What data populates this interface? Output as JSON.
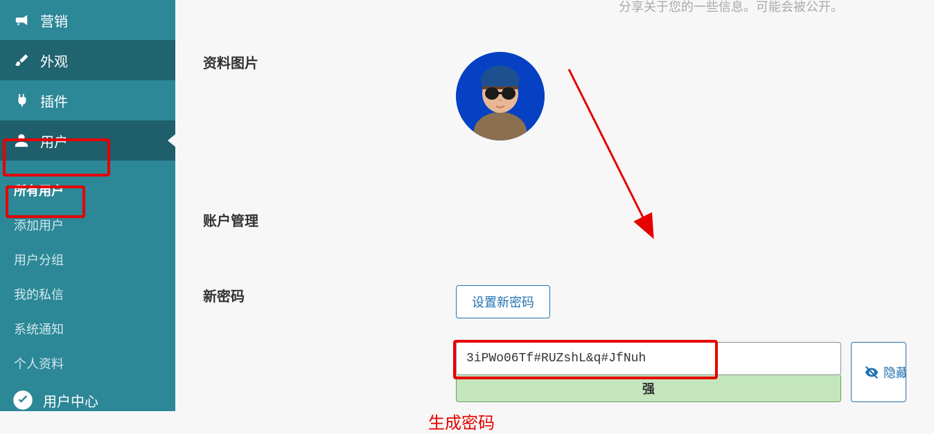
{
  "sidebar": {
    "items": [
      {
        "label": "营销",
        "icon": "megaphone-icon",
        "dark": false
      },
      {
        "label": "外观",
        "icon": "brush-icon",
        "dark": true
      },
      {
        "label": "插件",
        "icon": "plug-icon",
        "dark": false
      },
      {
        "label": "用户",
        "icon": "user-icon",
        "dark": true,
        "active": true
      }
    ],
    "sub_items": [
      {
        "label": "所有用户",
        "highlight": true
      },
      {
        "label": "添加用户",
        "highlight": false
      },
      {
        "label": "用户分组",
        "highlight": false
      },
      {
        "label": "我的私信",
        "highlight": false
      },
      {
        "label": "系统通知",
        "highlight": false
      },
      {
        "label": "个人资料",
        "highlight": false
      }
    ],
    "footer_label": "用户中心"
  },
  "main": {
    "truncated_header": "分享关于您的一些信息。可能会被公开。",
    "profile_image_label": "资料图片",
    "account_label": "账户管理",
    "new_password_label": "新密码",
    "set_password_button": "设置新密码",
    "password_value": "3iPWo06Tf#RUZshL&q#JfNuh",
    "strength_label": "强",
    "hide_button": "隐藏",
    "generate_label": "生成密码"
  }
}
